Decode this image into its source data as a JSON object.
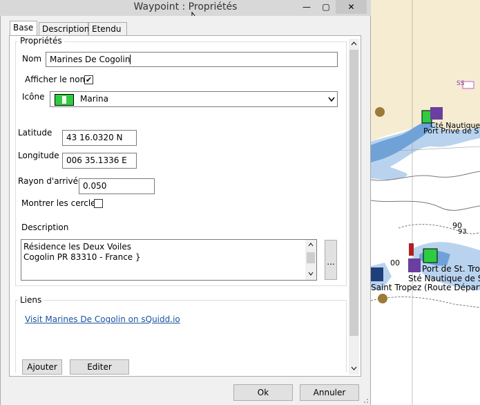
{
  "window": {
    "title": "Waypoint : Propriétés",
    "minimize_icon": "—",
    "maximize_icon": "▢",
    "close_icon": "✕"
  },
  "tabs": [
    {
      "label": "Base"
    },
    {
      "label": "Description"
    },
    {
      "label": "Etendu"
    }
  ],
  "properties": {
    "group_label": "Propriétés",
    "name_label": "Nom",
    "name_value": "Marines De Cogolin",
    "show_name_label": "Afficher le nom",
    "show_name_checked": "✔",
    "icon_label": "Icône",
    "icon_value": "Marina",
    "latitude_label": "Latitude",
    "latitude_value": "43 16.0320 N",
    "longitude_label": "Longitude",
    "longitude_value": "006 35.1336 E",
    "radius_label": "Rayon d'arrivée",
    "radius_value": "0.050",
    "show_circles_label": "Montrer les cercles",
    "description_label": "Description",
    "description_line1": "Résidence les Deux Voiles",
    "description_line2": "Cogolin PR 83310 - France }",
    "description_more_button": "..."
  },
  "links": {
    "group_label": "Liens",
    "link_text": "Visit Marines De Cogolin on sQuidd.io",
    "add_button": "Ajouter",
    "edit_button": "Editer"
  },
  "footer": {
    "ok_button": "Ok",
    "cancel_button": "Annuler"
  },
  "map": {
    "label_ss": "SS",
    "label_cogolin_1": "Cté Nautique",
    "label_cogolin_2": "Port Privé de S",
    "label_depth": "90",
    "label_depth2": "93",
    "label_port1": "Port de St. Tro",
    "label_port2": "Sté Nautique de St",
    "label_port3": "Saint Tropez",
    "label_port4": "(Route Départe",
    "label_depth3": "00"
  },
  "colors": {
    "land": "#f5ecd2",
    "water_shallow": "#6fa2d8",
    "water_mid": "#b9d3ef",
    "water_deep": "#ffffff",
    "accent_link": "#1a52a0",
    "marina_icon_green": "#2ecc40",
    "flag_purple": "#6b3fa0"
  }
}
